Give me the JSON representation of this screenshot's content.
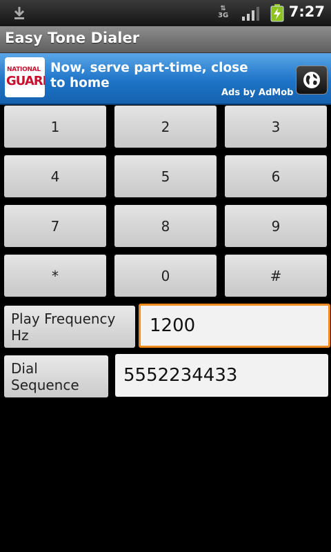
{
  "status_bar": {
    "time": "7:27",
    "network": "3G",
    "icons": [
      "download-icon",
      "3g-data-icon",
      "signal-icon",
      "battery-charging-icon"
    ]
  },
  "app": {
    "title": "Easy Tone Dialer"
  },
  "ad": {
    "logo_top": "NATIONAL",
    "logo_bottom": "GUARD",
    "headline": "Now, serve part-time, close to home",
    "attribution": "Ads by AdMob",
    "button_icon": "globe-icon"
  },
  "keypad": {
    "keys": [
      "1",
      "2",
      "3",
      "4",
      "5",
      "6",
      "7",
      "8",
      "9",
      "*",
      "0",
      "#"
    ]
  },
  "frequency": {
    "button_label": "Play Frequency Hz",
    "value": "1200"
  },
  "dial": {
    "button_label": "Dial Sequence",
    "value": "5552234433"
  },
  "colors": {
    "accent_focus": "#f08a1c",
    "ad_blue": "#1e74c7"
  }
}
